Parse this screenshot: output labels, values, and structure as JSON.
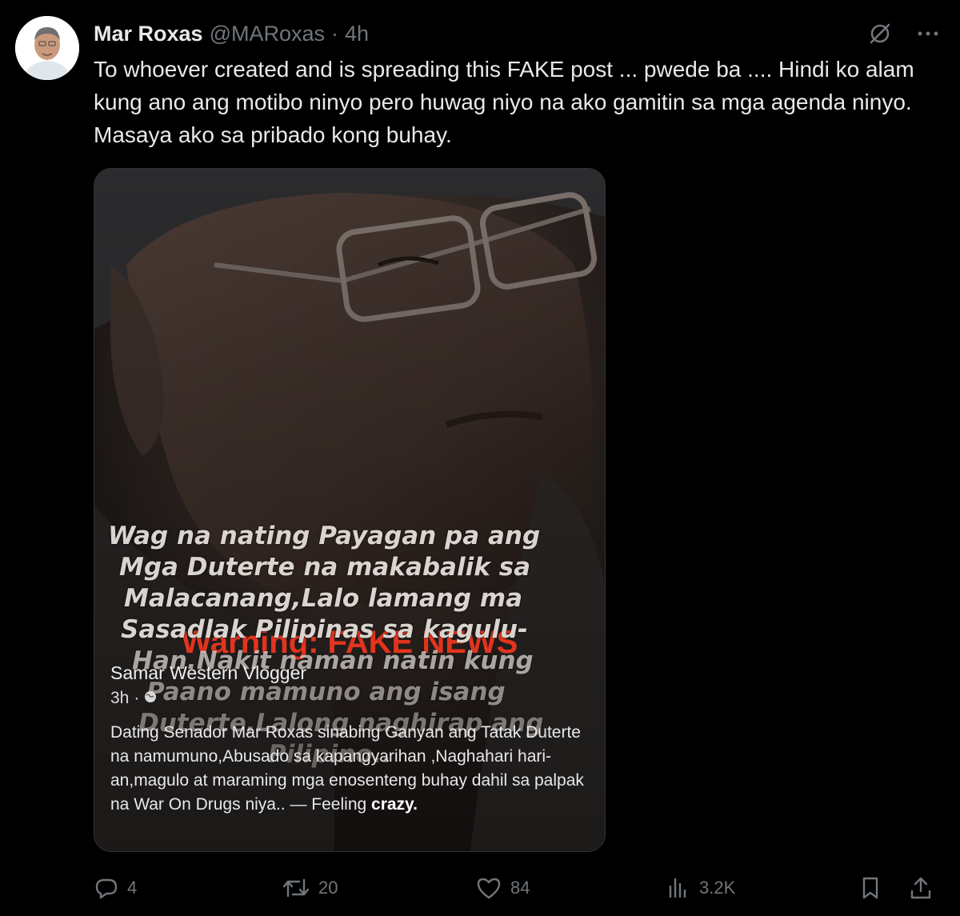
{
  "author": {
    "name": "Mar Roxas",
    "handle": "@MARoxas",
    "separator": "·",
    "time": "4h"
  },
  "tweet": {
    "text": "To whoever created and is spreading this FAKE post ... pwede ba .... Hindi ko alam kung ano ang motibo ninyo pero huwag niyo na ako gamitin sa mga agenda ninyo. Masaya ako sa pribado kong buhay."
  },
  "media": {
    "warning": "Warning: FAKE NEWS",
    "overlay_lines": [
      "Wag na nating Payagan pa ang",
      "Mga Duterte na makabalik sa",
      "Malacanang,Lalo lamang ma",
      "Sasadlak Pilipinas sa kagulu-",
      "Han.Nakit naman natin kung",
      "Paano mamuno ang isang",
      "Duterte,Lalong naghirap ang",
      "Pilipino.."
    ],
    "fb_post": {
      "page_name": "Samar Western Vlogger",
      "time": "3h",
      "separator": "·",
      "body": "Dating Senador Mar Roxas sinabing Ganyan ang Tatak Duterte na namumuno,Abusado sa kapangyarihan ,Naghahari hari-an,magulo at maraming mga enosenteng buhay dahil sa palpak na War On Drugs niya.. — Feeling",
      "feeling": "crazy."
    }
  },
  "actions": {
    "replies": "4",
    "reposts": "20",
    "likes": "84",
    "views": "3.2K"
  },
  "icons": {
    "grok": "grok-icon",
    "more": "more-icon",
    "reply": "reply-icon",
    "repost": "repost-icon",
    "like": "like-icon",
    "views": "views-icon",
    "bookmark": "bookmark-icon",
    "share": "share-icon"
  },
  "colors": {
    "background": "#000000",
    "text": "#e7e9ea",
    "muted": "#71767b",
    "warning": "#e3341e"
  }
}
